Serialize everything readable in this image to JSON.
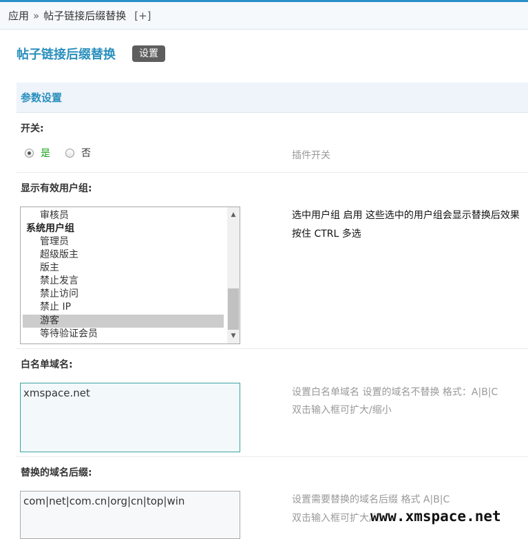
{
  "breadcrumb": {
    "app": "应用",
    "separator": "»",
    "page": "帖子链接后缀替换",
    "add": "[+]"
  },
  "plugin": {
    "title": "帖子链接后缀替换",
    "settings_badge": "设置"
  },
  "section": {
    "title": "参数设置"
  },
  "switch": {
    "label": "开关:",
    "yes": "是",
    "no": "否",
    "selected": "yes",
    "desc": "插件开关"
  },
  "usergroups": {
    "label": "显示有效用户组:",
    "options": [
      {
        "text": "审核员",
        "kind": "indent",
        "selected": false
      },
      {
        "text": "系统用户组",
        "kind": "group",
        "selected": false
      },
      {
        "text": "管理员",
        "kind": "indent",
        "selected": false
      },
      {
        "text": "超级版主",
        "kind": "indent",
        "selected": false
      },
      {
        "text": "版主",
        "kind": "indent",
        "selected": false
      },
      {
        "text": "禁止发言",
        "kind": "indent",
        "selected": false
      },
      {
        "text": "禁止访问",
        "kind": "indent",
        "selected": false
      },
      {
        "text": "禁止 IP",
        "kind": "indent",
        "selected": false
      },
      {
        "text": "游客",
        "kind": "indent",
        "selected": true
      },
      {
        "text": "等待验证会员",
        "kind": "indent",
        "selected": false
      }
    ],
    "desc_line1": "选中用户组 启用 这些选中的用户组会显示替换后效果",
    "desc_line2": "按住 CTRL 多选"
  },
  "whitelist": {
    "label": "白名单域名:",
    "value": "xmspace.net",
    "desc_line1": "设置白名单域名 设置的域名不替换 格式：A|B|C",
    "desc_line2": "双击输入框可扩大/缩小"
  },
  "suffix": {
    "label": "替换的域名后缀:",
    "value": "com|net|com.cn|org|cn|top|win",
    "desc_line1": "设置需要替换的域名后缀 格式 A|B|C",
    "desc_line2": "双击输入框可扩大/缩小"
  },
  "watermark": "www.xmspace.net",
  "colors": {
    "accent": "#2a8fbd",
    "yes": "#1aa51a",
    "badge": "#5e5e5e"
  }
}
